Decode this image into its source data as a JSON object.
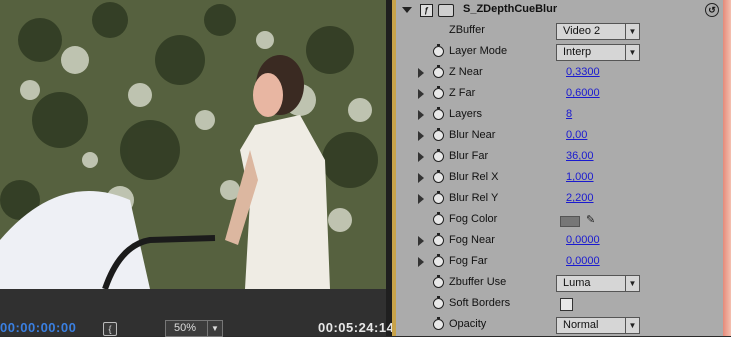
{
  "monitor": {
    "current_timecode": "00:00:00:00",
    "zoom": "50%",
    "duration_timecode": "00:05:24:14",
    "mark_icon": "mark-in-icon"
  },
  "effect": {
    "name": "S_ZDepthCueBlur",
    "parameters": [
      {
        "label": "ZBuffer",
        "type": "dropdown",
        "value": "Video 2",
        "expandable": false,
        "stopwatch": false
      },
      {
        "label": "Layer Mode",
        "type": "dropdown",
        "value": "Interp",
        "expandable": false,
        "stopwatch": true
      },
      {
        "label": "Z Near",
        "type": "number",
        "value": "0,3300",
        "expandable": true,
        "stopwatch": true
      },
      {
        "label": "Z Far",
        "type": "number",
        "value": "0,6000",
        "expandable": true,
        "stopwatch": true
      },
      {
        "label": "Layers",
        "type": "number",
        "value": "8",
        "expandable": true,
        "stopwatch": true
      },
      {
        "label": "Blur Near",
        "type": "number",
        "value": "0,00",
        "expandable": true,
        "stopwatch": true
      },
      {
        "label": "Blur Far",
        "type": "number",
        "value": "36,00",
        "expandable": true,
        "stopwatch": true
      },
      {
        "label": "Blur Rel X",
        "type": "number",
        "value": "1,000",
        "expandable": true,
        "stopwatch": true
      },
      {
        "label": "Blur Rel Y",
        "type": "number",
        "value": "2,200",
        "expandable": true,
        "stopwatch": true
      },
      {
        "label": "Fog Color",
        "type": "color",
        "value": "#777777",
        "expandable": false,
        "stopwatch": true
      },
      {
        "label": "Fog Near",
        "type": "number",
        "value": "0,0000",
        "expandable": true,
        "stopwatch": true
      },
      {
        "label": "Fog Far",
        "type": "number",
        "value": "0,0000",
        "expandable": true,
        "stopwatch": true
      },
      {
        "label": "Zbuffer Use",
        "type": "dropdown",
        "value": "Luma",
        "expandable": false,
        "stopwatch": true
      },
      {
        "label": "Soft Borders",
        "type": "checkbox",
        "value": "",
        "expandable": false,
        "stopwatch": true
      },
      {
        "label": "Opacity",
        "type": "dropdown",
        "value": "Normal",
        "expandable": false,
        "stopwatch": true
      }
    ]
  },
  "colors": {
    "panel_bg": "#ababab",
    "value_link": "#1a1ad0",
    "timecode_active": "#3a7fe0"
  }
}
